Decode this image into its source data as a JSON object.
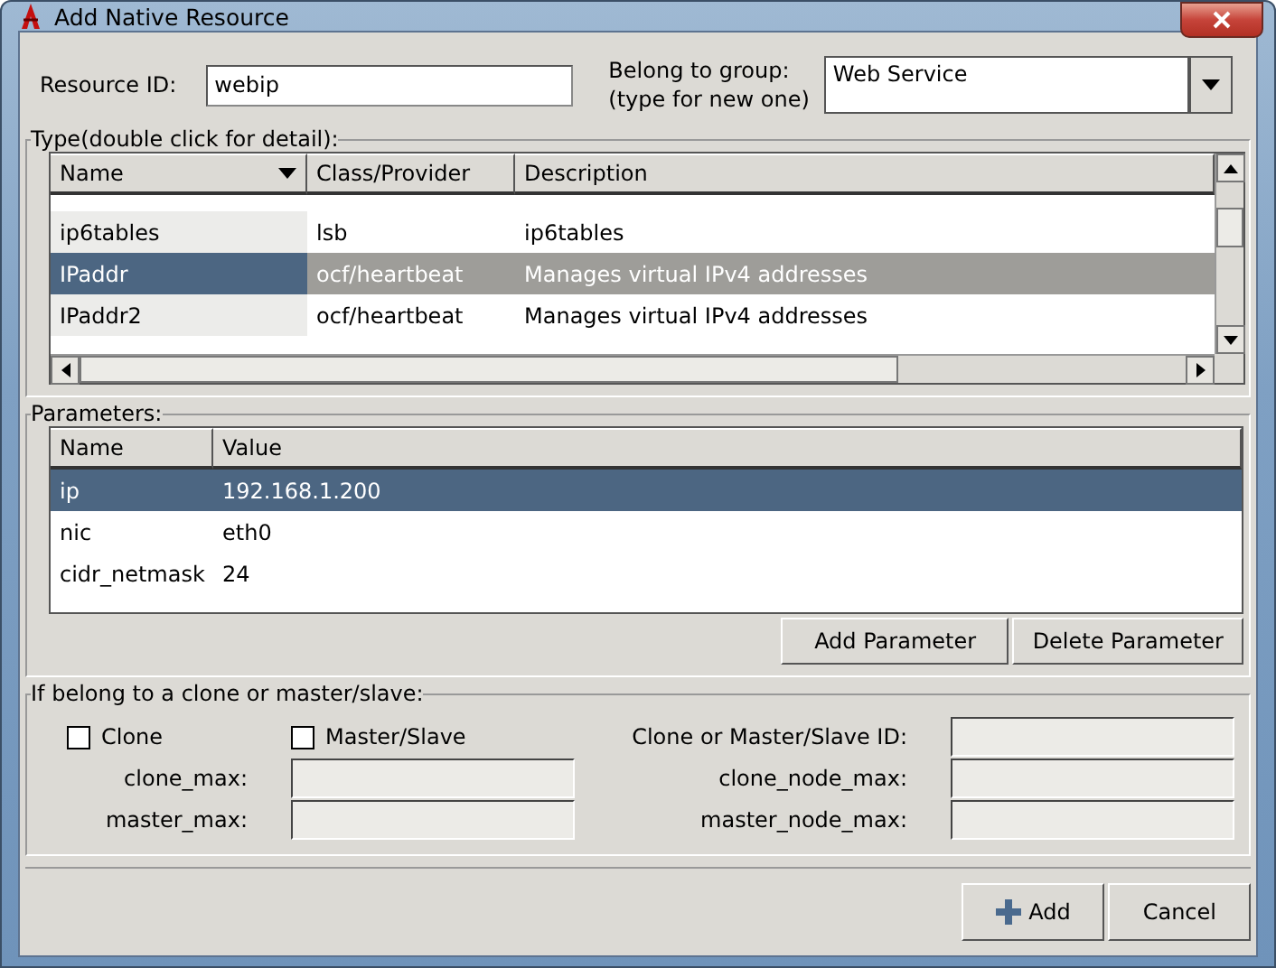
{
  "window": {
    "title": "Add Native Resource"
  },
  "resource_id": {
    "label": "Resource ID:",
    "value": "webip"
  },
  "group": {
    "label_lines": [
      "Belong to group:",
      "(type for new one)"
    ],
    "value": "Web Service"
  },
  "type_section": {
    "title": "Type(double click for detail):",
    "columns": [
      {
        "label": "Name",
        "sorted": true
      },
      {
        "label": "Class/Provider",
        "sorted": false
      },
      {
        "label": "Description",
        "sorted": false
      }
    ],
    "rows": [
      {
        "name": "ip6tables",
        "provider": "lsb",
        "description": "ip6tables",
        "selected": false
      },
      {
        "name": "IPaddr",
        "provider": "ocf/heartbeat",
        "description": "Manages virtual IPv4 addresses",
        "selected": true
      },
      {
        "name": "IPaddr2",
        "provider": "ocf/heartbeat",
        "description": "Manages virtual IPv4 addresses",
        "selected": false
      }
    ]
  },
  "parameters": {
    "title": "Parameters:",
    "columns": [
      "Name",
      "Value"
    ],
    "rows": [
      {
        "name": "ip",
        "value": "192.168.1.200",
        "selected": true
      },
      {
        "name": "nic",
        "value": "eth0",
        "selected": false
      },
      {
        "name": "cidr_netmask",
        "value": "24",
        "selected": false
      }
    ],
    "buttons": [
      "Add Parameter",
      "Delete Parameter"
    ]
  },
  "clone": {
    "title": "If belong to a clone or master/slave:",
    "checkboxes": [
      {
        "label": "Clone",
        "checked": false
      },
      {
        "label": "Master/Slave",
        "checked": false
      }
    ],
    "id_label": "Clone or Master/Slave ID:",
    "fields": [
      {
        "label": "clone_max:"
      },
      {
        "label": "clone_node_max:"
      },
      {
        "label": "master_max:"
      },
      {
        "label": "master_node_max:"
      }
    ]
  },
  "buttons": [
    {
      "label": "Add",
      "kind": "add"
    },
    {
      "label": "Cancel",
      "kind": "plain"
    }
  ]
}
